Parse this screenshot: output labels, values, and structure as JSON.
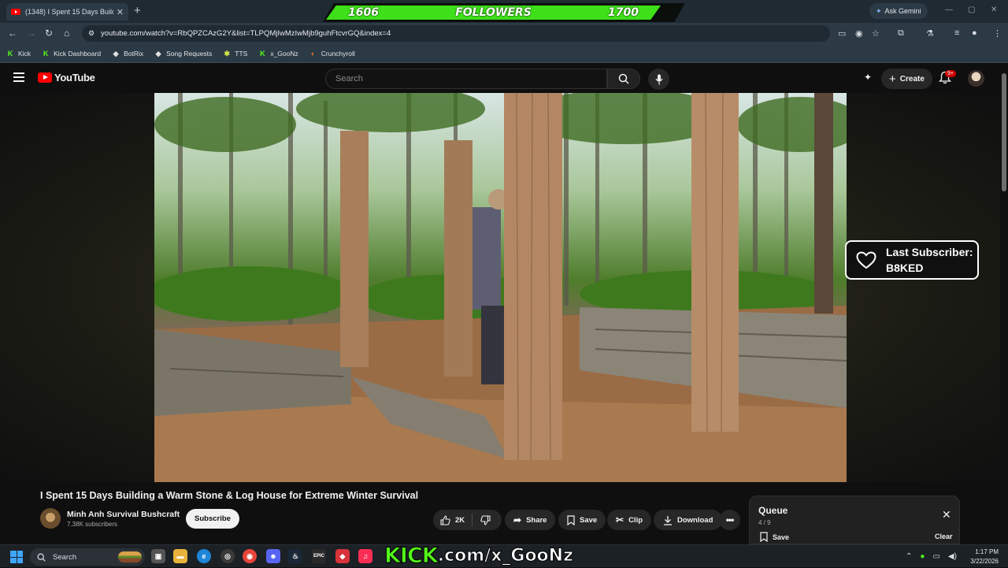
{
  "browser": {
    "tab_title": "(1348) I Spent 15 Days Buildi",
    "new_tab_label": "+",
    "ask_gemini": "Ask Gemini",
    "url": "youtube.com/watch?v=RbQPZCAzG2Y&list=TLPQMjIwMzIwMjb9guhFtcvrGQ&index=4",
    "bookmarks": [
      {
        "label": "Kick",
        "icon": "kick-icon",
        "color": "#53fc18"
      },
      {
        "label": "Kick Dashboard",
        "icon": "kick-icon",
        "color": "#53fc18"
      },
      {
        "label": "BotRix",
        "icon": "botrix-icon",
        "color": "#ffffff"
      },
      {
        "label": "Song Requests",
        "icon": "music-icon",
        "color": "#ffffff"
      },
      {
        "label": "TTS",
        "icon": "tts-icon",
        "color": "#d4e84a"
      },
      {
        "label": "x_GooNz",
        "icon": "kick-icon",
        "color": "#53fc18"
      },
      {
        "label": "Crunchyroll",
        "icon": "crunchyroll-icon",
        "color": "#f47521"
      }
    ]
  },
  "overlay": {
    "followers_current": "1606",
    "followers_label": "FOLLOWERS",
    "followers_goal": "1700",
    "last_subscriber_label": "Last Subscriber:",
    "last_subscriber_name": "B8KED",
    "kick_brand": "KICK",
    "kick_rest": ".com/x_GooNz"
  },
  "youtube": {
    "logo_text": "YouTube",
    "search_placeholder": "Search",
    "create_label": "Create",
    "notifications_badge": "9+",
    "video_title": "I Spent 15 Days Building a Warm Stone & Log House for Extreme Winter Survival",
    "channel_name": "Minh Anh Survival Bushcraft",
    "channel_subscribers": "7.38K subscribers",
    "subscribe_label": "Subscribe",
    "like_count": "2K",
    "share_label": "Share",
    "save_label": "Save",
    "clip_label": "Clip",
    "download_label": "Download",
    "queue": {
      "title": "Queue",
      "count": "4 / 9",
      "save_label": "Save",
      "clear_label": "Clear"
    }
  },
  "taskbar": {
    "search_label": "Search",
    "time": "1:17 PM",
    "date": "3/22/2026"
  },
  "colors": {
    "kick_green": "#53fc18",
    "youtube_red": "#ff0000",
    "background": "#0f0f0f"
  }
}
